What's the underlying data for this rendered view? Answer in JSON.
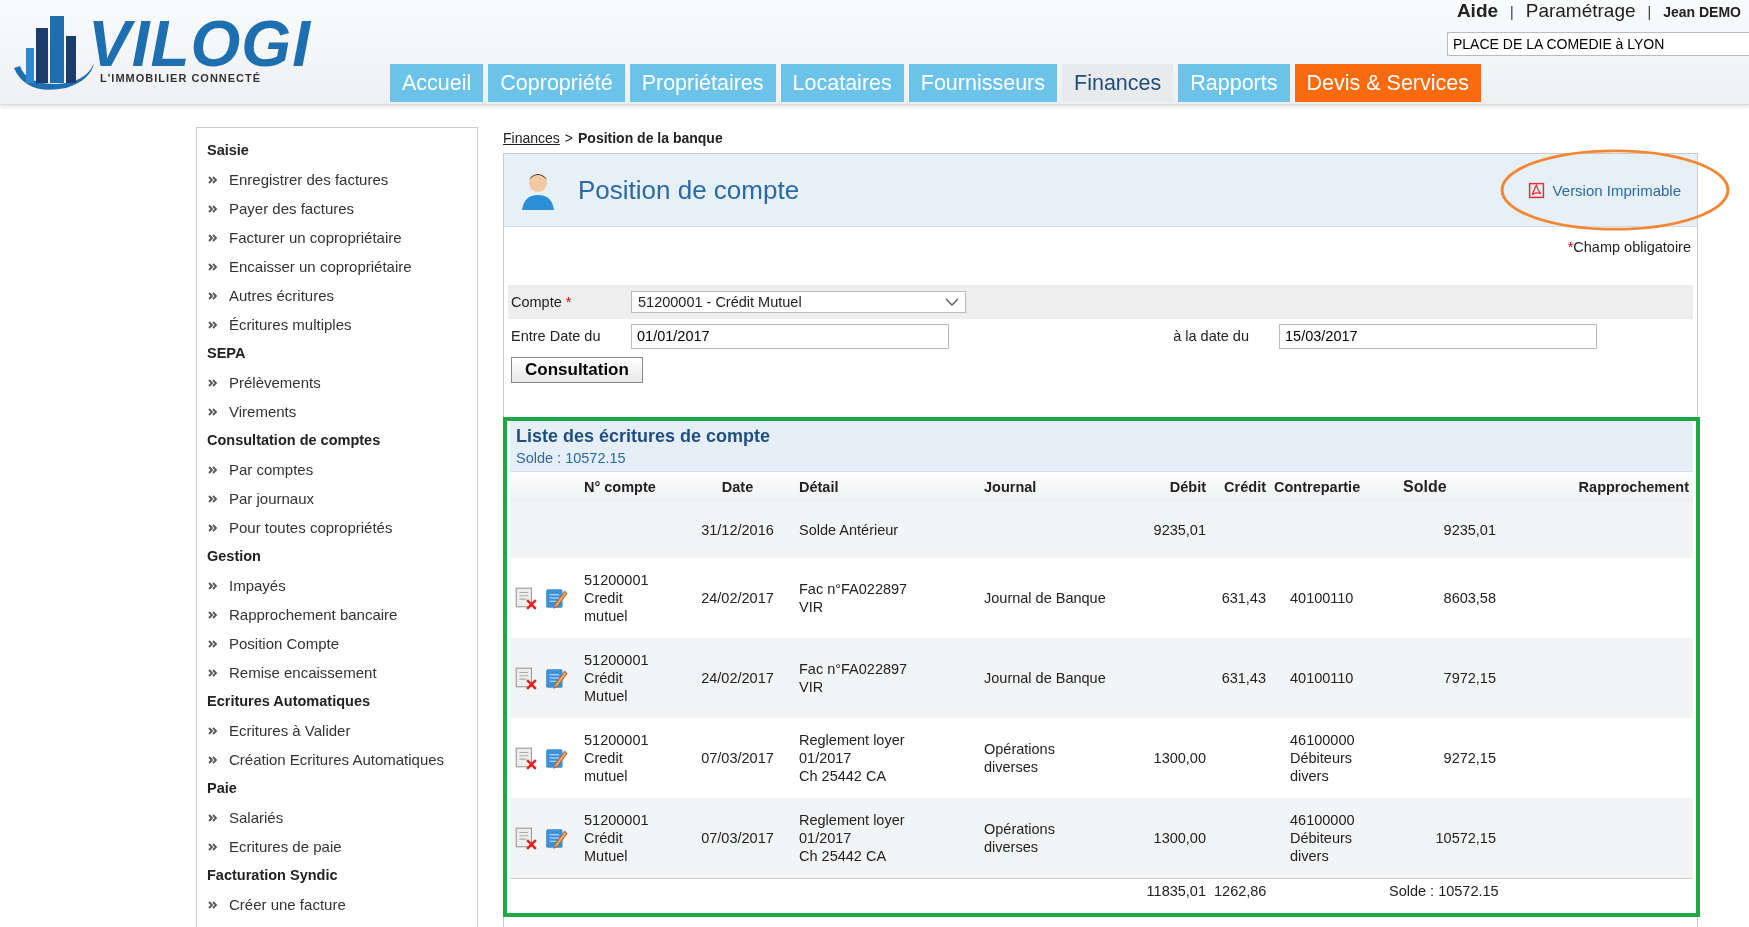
{
  "logo": {
    "name": "VILOGI",
    "tagline": "L'IMMOBILIER CONNECTÉ"
  },
  "top_links": [
    {
      "label": "Aide",
      "kind": "big-bold"
    },
    {
      "label": "Paramétrage",
      "kind": "big"
    },
    {
      "label": "Jean DEMO",
      "kind": "small-bold"
    }
  ],
  "top_link_separator": "|",
  "property_field": {
    "value": "PLACE DE LA COMEDIE à LYON"
  },
  "tabs": [
    {
      "label": "Accueil",
      "selected": false,
      "kind": "normal"
    },
    {
      "label": "Copropriété",
      "selected": false,
      "kind": "normal"
    },
    {
      "label": "Propriétaires",
      "selected": false,
      "kind": "normal"
    },
    {
      "label": "Locataires",
      "selected": false,
      "kind": "normal"
    },
    {
      "label": "Fournisseurs",
      "selected": false,
      "kind": "normal"
    },
    {
      "label": "Finances",
      "selected": true,
      "kind": "normal"
    },
    {
      "label": "Rapports",
      "selected": false,
      "kind": "normal"
    },
    {
      "label": "Devis & Services",
      "selected": false,
      "kind": "accent"
    }
  ],
  "sidebar": {
    "sections": [
      {
        "title": "Saisie",
        "items": [
          "Enregistrer des factures",
          "Payer des factures",
          "Facturer un copropriétaire",
          "Encaisser un copropriétaire",
          "Autres écritures",
          "Écritures multiples"
        ]
      },
      {
        "title": "SEPA",
        "items": [
          "Prélèvements",
          "Virements"
        ]
      },
      {
        "title": "Consultation de comptes",
        "items": [
          "Par comptes",
          "Par journaux",
          "Pour toutes copropriétés"
        ]
      },
      {
        "title": "Gestion",
        "items": [
          "Impayés",
          "Rapprochement bancaire",
          "Position Compte",
          "Remise encaissement"
        ]
      },
      {
        "title": "Ecritures Automatiques",
        "items": [
          "Ecritures à Valider",
          "Création Ecritures Automatiques"
        ]
      },
      {
        "title": "Paie",
        "items": [
          "Salariés",
          "Ecritures de paie"
        ]
      },
      {
        "title": "Facturation Syndic",
        "items": [
          "Créer une facture"
        ]
      }
    ]
  },
  "breadcrumb": {
    "link": "Finances",
    "separator": ">",
    "current": "Position de la banque"
  },
  "panel": {
    "title": "Position de compte",
    "print_link": "Version Imprimable",
    "required_mark": "*",
    "required_note": "Champ obligatoire"
  },
  "form": {
    "account_label": "Compte",
    "account_value": "51200001 - Crédit Mutuel",
    "from_label": "Entre Date du",
    "from_value": "01/01/2017",
    "to_label": "à la date du",
    "to_value": "15/03/2017",
    "submit": "Consultation"
  },
  "list": {
    "title": "Liste des écritures de compte",
    "balance": "Solde : 10572.15",
    "columns": [
      "N° compte",
      "Date",
      "Détail",
      "Journal",
      "Débit",
      "Crédit",
      "Contrepartie",
      "Solde",
      "Rapprochement"
    ],
    "rows": [
      {
        "has_actions": false,
        "account": "",
        "date": "31/12/2016",
        "detail": "Solde Antérieur",
        "journal": "",
        "debit": "9235,01",
        "credit": "",
        "counterpart": "",
        "balance": "9235,01"
      },
      {
        "has_actions": true,
        "account": "51200001\nCredit\nmutuel",
        "date": "24/02/2017",
        "detail": "Fac n°FA022897\nVIR",
        "journal": "Journal de Banque",
        "debit": "",
        "credit": "631,43",
        "counterpart": "40100110",
        "balance": "8603,58"
      },
      {
        "has_actions": true,
        "account": "51200001\nCrédit\nMutuel",
        "date": "24/02/2017",
        "detail": "Fac n°FA022897\nVIR",
        "journal": "Journal de Banque",
        "debit": "",
        "credit": "631,43",
        "counterpart": "40100110",
        "balance": "7972,15"
      },
      {
        "has_actions": true,
        "account": "51200001\nCredit\nmutuel",
        "date": "07/03/2017",
        "detail": "Reglement loyer\n01/2017\nCh 25442 CA",
        "journal": "Opérations\ndiverses",
        "debit": "1300,00",
        "credit": "",
        "counterpart": "46100000\nDébiteurs\ndivers",
        "balance": "9272,15"
      },
      {
        "has_actions": true,
        "account": "51200001\nCrédit\nMutuel",
        "date": "07/03/2017",
        "detail": "Reglement loyer\n01/2017\nCh 25442 CA",
        "journal": "Opérations\ndiverses",
        "debit": "1300,00",
        "credit": "",
        "counterpart": "46100000\nDébiteurs\ndivers",
        "balance": "10572,15"
      }
    ],
    "totals": {
      "debit": "11835,01",
      "credit": "1262,86",
      "balance": "Solde : 10572.15"
    }
  }
}
